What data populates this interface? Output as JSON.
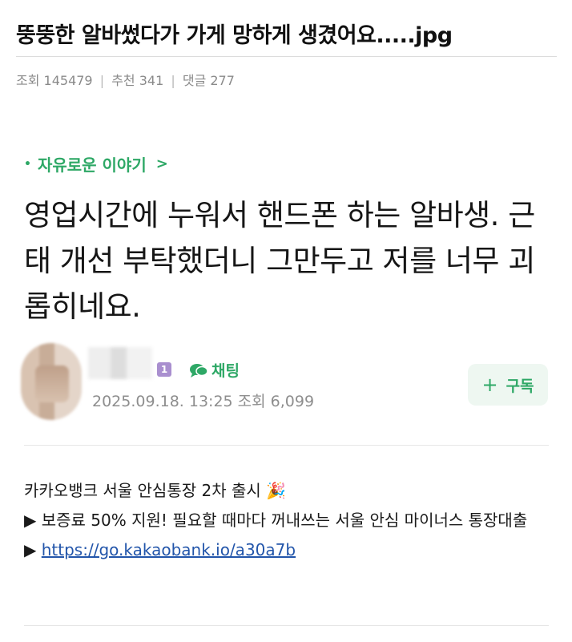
{
  "post": {
    "title": "뚱뚱한 알바썼다가 가게 망하게 생겼어요.....jpg",
    "meta": {
      "views_label": "조회 145479",
      "recommend_label": "추천 341",
      "comments_label": "댓글 277",
      "separator": "|"
    }
  },
  "article": {
    "category": "자유로운 이야기",
    "category_bullet": "•",
    "category_chevron": ">",
    "heading": "영업시간에 누워서 핸드폰 하는 알바생. 근태 개선 부탁했더니 그만두고 저를 너무 괴롭히네요."
  },
  "author": {
    "level_badge": "1",
    "chat_label": "채팅",
    "date_line": "2025.09.18. 13:25 조회 6,099",
    "subscribe_plus": "+",
    "subscribe_label": "구독"
  },
  "ad": {
    "line1": "카카오뱅크 서울 안심통장 2차 출시 🎉",
    "line2_arrow": "▶",
    "line2": "보증료 50% 지원! 필요할 때마다 꺼내쓰는 서울 안심 마이너스 통장대출",
    "line3_arrow": "▶",
    "link": "https://go.kakaobank.io/a30a7b"
  },
  "colors": {
    "accent_green": "#2ea866",
    "link_blue": "#2255aa",
    "badge_purple": "#a98fcf"
  }
}
